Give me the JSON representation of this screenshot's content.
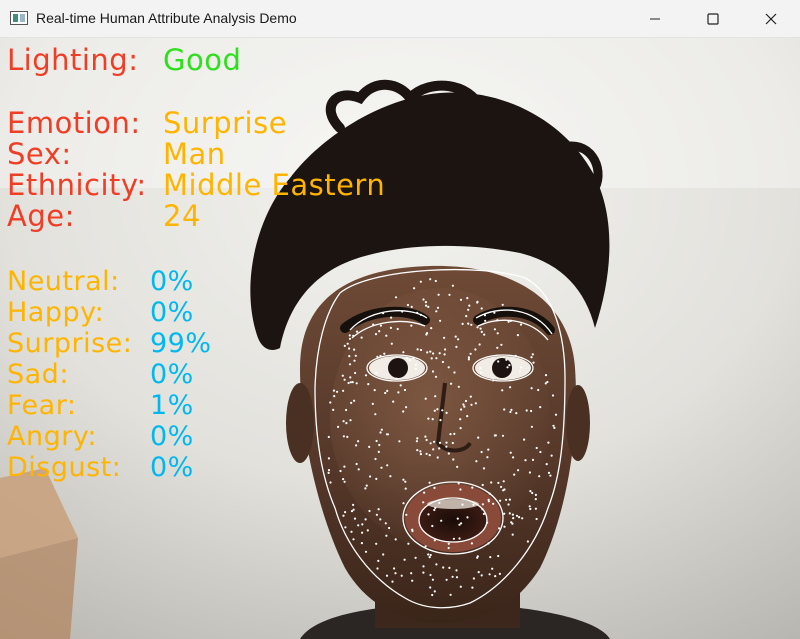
{
  "window": {
    "title": "Real-time Human Attribute Analysis Demo",
    "icon": "app-window-icon",
    "controls": [
      "minimize-icon",
      "maximize-icon",
      "close-icon"
    ]
  },
  "analysis": {
    "lighting": {
      "label": "Lighting:",
      "value": "Good"
    },
    "attributes": [
      {
        "label": "Emotion:",
        "value": "Surprise"
      },
      {
        "label": "Sex:",
        "value": "Man"
      },
      {
        "label": "Ethnicity:",
        "value": "Middle Eastern"
      },
      {
        "label": "Age:",
        "value": "24"
      }
    ],
    "emotion_probabilities": [
      {
        "label": "Neutral:",
        "value": "0%"
      },
      {
        "label": "Happy:",
        "value": "0%"
      },
      {
        "label": "Surprise:",
        "value": "99%"
      },
      {
        "label": "Sad:",
        "value": "0%"
      },
      {
        "label": "Fear:",
        "value": "1%"
      },
      {
        "label": "Angry:",
        "value": "0%"
      },
      {
        "label": "Disgust:",
        "value": "0%"
      }
    ]
  },
  "colors": {
    "label_red": "#f03d25",
    "value_orange": "#ffb400",
    "good_green": "#2ee01c",
    "prob_blue": "#00b8f0",
    "mesh_white": "#ffffff"
  }
}
